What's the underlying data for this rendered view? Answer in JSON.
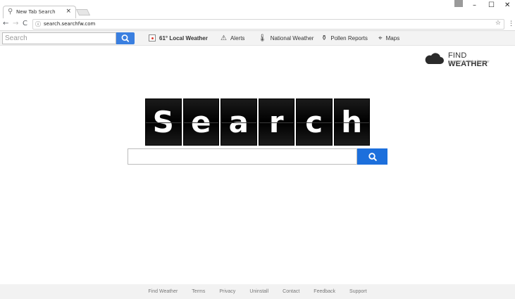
{
  "browser": {
    "tab_title": "New Tab Search",
    "tab_close": "×",
    "url": "search.searchfw.com",
    "window_controls": [
      "–",
      "☐",
      "✕"
    ],
    "nav": {
      "back": "←",
      "forward": "→",
      "reload": "C"
    }
  },
  "toolbar": {
    "search_placeholder": "Search",
    "items": [
      {
        "icon": "thermometer-box-icon",
        "label_bold": "61° Local Weather"
      },
      {
        "icon": "alert-icon",
        "label": "Alerts"
      },
      {
        "icon": "thermometer-icon",
        "label": "National Weather"
      },
      {
        "icon": "pollen-icon",
        "label": "Pollen Reports"
      },
      {
        "icon": "map-pin-icon",
        "label": "Maps"
      }
    ]
  },
  "logo": {
    "brand_light": "FIND ",
    "brand_bold": "WEATHER",
    "tagline": "powered by Safer Browser"
  },
  "search_tiles": [
    "S",
    "e",
    "a",
    "r",
    "c",
    "h"
  ],
  "main_search": {
    "placeholder": ""
  },
  "footer": {
    "links": [
      "Find Weather",
      "Terms",
      "Privacy",
      "Uninstall",
      "Contact",
      "Feedback",
      "Support"
    ]
  },
  "colors": {
    "accent": "#1c6fdc",
    "toolbar_button": "#3a7fe0",
    "footer_bg": "#f2f2f2"
  }
}
